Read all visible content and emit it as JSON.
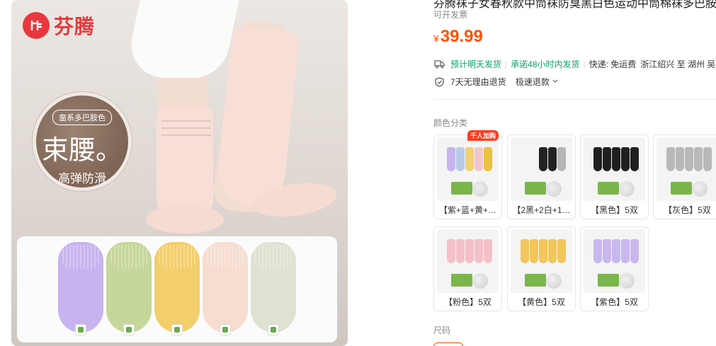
{
  "brand": {
    "logo_glyph": "fr",
    "name": "芬腾"
  },
  "hero_badge": {
    "tag": "奤系多巴胺色",
    "main": "束腰。",
    "sub": "高弹防滑"
  },
  "tray_socks": [
    "#c7b4ee",
    "#c5d79a",
    "#f3cf6b",
    "#f6ddd0",
    "#dfe2d2"
  ],
  "product": {
    "title": "芬腾袜子女春秋款中筒袜防臭黑白色运动中筒棉袜多巴胺",
    "subline": "可开发票",
    "price_currency": "¥",
    "price_value": "39.99"
  },
  "shipping": {
    "tag1": "预计明天发货",
    "separator": "|",
    "tag2": "承诺48小时内发货",
    "courier": "快递: 免运费",
    "route": "浙江绍兴 至 湖州 吴兴"
  },
  "returns": {
    "policy": "7天无理由退货",
    "refund": "极速退款"
  },
  "colors": {
    "section_label": "颜色分类",
    "hot_tag": "千人加购",
    "items": [
      {
        "label": "【紫+蓝+黄+…",
        "swatches": [
          "#c8b3ec",
          "#b7cbe9",
          "#f2d074",
          "#f3c6cf",
          "#e9c23e"
        ]
      },
      {
        "label": "【2黑+2白+1…",
        "swatches": [
          "#f5f5f5",
          "#f5f5f5",
          "#222222",
          "#222222",
          "#b5b5b5"
        ]
      },
      {
        "label": "【黑色】5双",
        "swatches": [
          "#1f1f1f",
          "#1f1f1f",
          "#1f1f1f",
          "#1f1f1f",
          "#1f1f1f"
        ]
      },
      {
        "label": "【灰色】5双",
        "swatches": [
          "#b9b9b9",
          "#b9b9b9",
          "#b9b9b9",
          "#b9b9b9",
          "#b9b9b9"
        ]
      },
      {
        "label": "【粉色】5双",
        "swatches": [
          "#f4c0c8",
          "#f4c0c8",
          "#f4c0c8",
          "#f4c0c8",
          "#f4c0c8"
        ]
      },
      {
        "label": "【黄色】5双",
        "swatches": [
          "#f2c659",
          "#f2c659",
          "#f2c659",
          "#f2c659",
          "#f2c659"
        ]
      },
      {
        "label": "【紫色】5双",
        "swatches": [
          "#c9b8ee",
          "#c9b8ee",
          "#c9b8ee",
          "#c9b8ee",
          "#c9b8ee"
        ]
      }
    ]
  },
  "size": {
    "section_label": "尺码"
  },
  "accent_color": "#ff5000",
  "brand_color": "#e8383d",
  "ship_green": "#0aa06e"
}
